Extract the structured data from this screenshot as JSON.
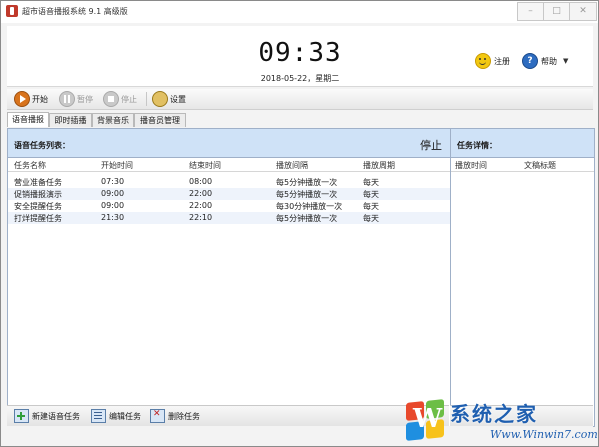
{
  "window": {
    "title": "超市语音播报系统 9.1 高级版",
    "controls": {
      "minimize": "–",
      "maximize": "□",
      "close": "✕"
    }
  },
  "header": {
    "time": "09:33",
    "date": "2018-05-22，星期二",
    "register_label": "注册",
    "help_label": "帮助",
    "help_glyph": "?"
  },
  "toolbar": {
    "start_label": "开始",
    "pause_label": "暂停",
    "stop_label": "停止",
    "settings_label": "设置"
  },
  "tabs": [
    {
      "label": "语音播报",
      "active": true
    },
    {
      "label": "即时插播",
      "active": false
    },
    {
      "label": "背景音乐",
      "active": false
    },
    {
      "label": "播音员管理",
      "active": false
    }
  ],
  "task_panel": {
    "title": "语音任务列表：",
    "status": "停止",
    "columns": [
      "任务名称",
      "开始时间",
      "结束时间",
      "播放间隔",
      "播放周期"
    ],
    "rows": [
      [
        "营业准备任务",
        "07:30",
        "08:00",
        "每5分钟播放一次",
        "每天"
      ],
      [
        "促销播报演示",
        "09:00",
        "22:00",
        "每5分钟播放一次",
        "每天"
      ],
      [
        "安全提醒任务",
        "09:00",
        "22:00",
        "每30分钟播放一次",
        "每天"
      ],
      [
        "打烊提醒任务",
        "21:30",
        "22:10",
        "每5分钟播放一次",
        "每天"
      ]
    ]
  },
  "detail_panel": {
    "title": "任务详情：",
    "columns": [
      "播放时间",
      "文稿标题"
    ]
  },
  "bottom_actions": {
    "new_label": "新建语音任务",
    "edit_label": "编辑任务",
    "delete_label": "删除任务"
  },
  "watermark": {
    "logo_letter": "W",
    "title": "系统之家",
    "url": "Www.Winwin7.com"
  },
  "colors": {
    "panel_header": "#cfe2f7",
    "accent_blue": "#1f5fb0",
    "play_orange": "#d8731c"
  }
}
